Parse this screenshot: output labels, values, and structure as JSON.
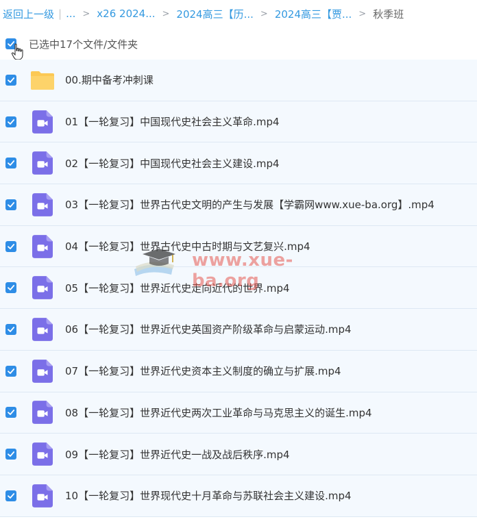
{
  "breadcrumb": {
    "back": "返回上一级",
    "ellipsis": "...",
    "items": [
      "x26 2024...",
      "2024高三【历...",
      "2024高三【贾..."
    ],
    "current": "秋季班"
  },
  "selection": {
    "text": "已选中17个文件/文件夹"
  },
  "files": [
    {
      "name": "00.期中备考冲刺课",
      "type": "folder"
    },
    {
      "name": "01【一轮复习】中国现代史社会主义革命.mp4",
      "type": "video"
    },
    {
      "name": "02【一轮复习】中国现代史社会主义建设.mp4",
      "type": "video"
    },
    {
      "name": "03【一轮复习】世界古代史文明的产生与发展【学霸网www.xue-ba.org】.mp4",
      "type": "video"
    },
    {
      "name": "04【一轮复习】世界古代史中古时期与文艺复兴.mp4",
      "type": "video"
    },
    {
      "name": "05【一轮复习】世界近代史走向近代的世界.mp4",
      "type": "video"
    },
    {
      "name": "06【一轮复习】世界近代史英国资产阶级革命与启蒙运动.mp4",
      "type": "video"
    },
    {
      "name": "07【一轮复习】世界近代史资本主义制度的确立与扩展.mp4",
      "type": "video"
    },
    {
      "name": "08【一轮复习】世界近代史两次工业革命与马克思主义的诞生.mp4",
      "type": "video"
    },
    {
      "name": "09【一轮复习】世界近代史一战及战后秩序.mp4",
      "type": "video"
    },
    {
      "name": "10【一轮复习】世界现代史十月革命与苏联社会主义建设.mp4",
      "type": "video"
    }
  ],
  "watermark": {
    "text": "www.xue-ba.org"
  },
  "colors": {
    "accent": "#2e8de6",
    "link": "#3399e0",
    "folder": "#fcc954",
    "video": "#7b6fe8",
    "row_bg": "#f4f9fe"
  }
}
